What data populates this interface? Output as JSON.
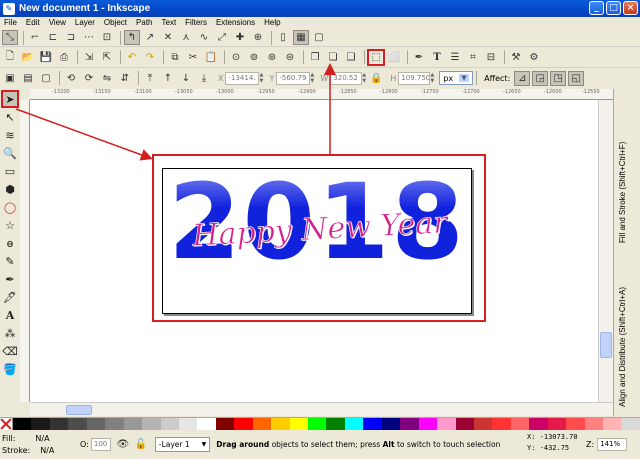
{
  "window": {
    "title": "New document 1 - Inkscape",
    "controls": [
      "_",
      "□",
      "×"
    ]
  },
  "menu": [
    "File",
    "Edit",
    "View",
    "Layer",
    "Object",
    "Path",
    "Text",
    "Filters",
    "Extensions",
    "Help"
  ],
  "selector_toolbar": {
    "x_label": "X",
    "x_value": "-13414.",
    "y_label": "Y",
    "y_value": "-560.79",
    "w_label": "W",
    "w_value": "320.52",
    "h_label": "H",
    "h_value": "109.750",
    "unit": "px",
    "affect_label": "Affect:"
  },
  "ruler": {
    "labels": [
      "-13200",
      "-13150",
      "-13100",
      "-13050",
      "-13000",
      "-12950",
      "-12900",
      "-12850",
      "-12800",
      "-12750",
      "-12700",
      "-12650",
      "-12600",
      "-12550"
    ]
  },
  "canvas": {
    "year_text": "2018",
    "script_text": "Happy New Year",
    "year_color": "#1122dd",
    "script_color": "#d51f8b",
    "annotation_color": "#d21f1f"
  },
  "dock_tabs": [
    "Fill and Stroke (Shift+Ctrl+F)",
    "Align and Distribute (Shift+Ctrl+A)"
  ],
  "palette": [
    "#000000",
    "#1a1a1a",
    "#333333",
    "#4d4d4d",
    "#666666",
    "#808080",
    "#999999",
    "#b3b3b3",
    "#cccccc",
    "#e6e6e6",
    "#ffffff",
    "#800000",
    "#ff0000",
    "#ff6600",
    "#ffcc00",
    "#ffff00",
    "#00ff00",
    "#008000",
    "#00ffff",
    "#0000ff",
    "#000080",
    "#800080",
    "#ff00ff",
    "#ff99cc",
    "#990033",
    "#cc3333",
    "#ff3333",
    "#ff6666",
    "#cc0066",
    "#e6194b",
    "#ff4d4d",
    "#ff8080",
    "#ffb3b3",
    "#d9d9d9"
  ],
  "status": {
    "fill_label": "Fill:",
    "fill_value": "N/A",
    "stroke_label": "Stroke:",
    "stroke_value": "N/A",
    "opacity_label": "O:",
    "opacity_value": "100",
    "layer": "-Layer 1",
    "message_bold1": "Drag around",
    "message_mid": " objects to select them; press ",
    "message_bold2": "Alt",
    "message_end": " to switch to touch selection",
    "x_coord": "X: -13073.70",
    "y_coord": "Y:   -432.75",
    "zoom_label": "Z:",
    "zoom_value": "141%"
  }
}
